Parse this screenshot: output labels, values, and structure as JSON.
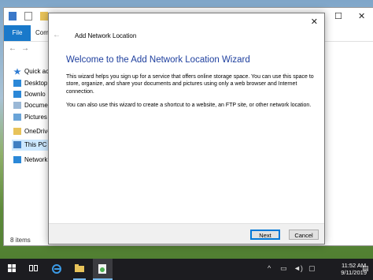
{
  "explorer": {
    "file_tab": "File",
    "computer_tab": "Comp",
    "window_controls": {
      "minimize": "–",
      "maximize": "☐",
      "close": "✕"
    },
    "nav": {
      "back": "←",
      "forward": "→"
    },
    "sidebar": [
      {
        "label": "Quick acc",
        "icon": "star-icon"
      },
      {
        "label": "Desktop",
        "icon": "desktop-icon"
      },
      {
        "label": "Downlo",
        "icon": "download-icon"
      },
      {
        "label": "Docume",
        "icon": "document-icon"
      },
      {
        "label": "Pictures",
        "icon": "pictures-icon"
      },
      {
        "label": "OneDrive",
        "icon": "cloud-icon"
      },
      {
        "label": "This PC",
        "icon": "pc-icon"
      },
      {
        "label": "Network",
        "icon": "network-icon"
      }
    ],
    "status": "8 items"
  },
  "wizard": {
    "title": "Add Network Location",
    "back_arrow": "←",
    "close": "✕",
    "heading": "Welcome to the Add Network Location Wizard",
    "paragraph1": "This wizard helps you sign up for a service that offers online storage space.  You can use this space to store, organize, and share your documents and pictures using only a web browser and Internet connection.",
    "paragraph2": "You can also use this wizard to create a shortcut to a website, an FTP site, or other network location.",
    "next_label": "Next",
    "cancel_label": "Cancel"
  },
  "taskbar": {
    "time": "11:52 AM",
    "date": "9/11/2019",
    "colors": {
      "background": "#1c1c20",
      "accent": "#76b9ed"
    }
  }
}
